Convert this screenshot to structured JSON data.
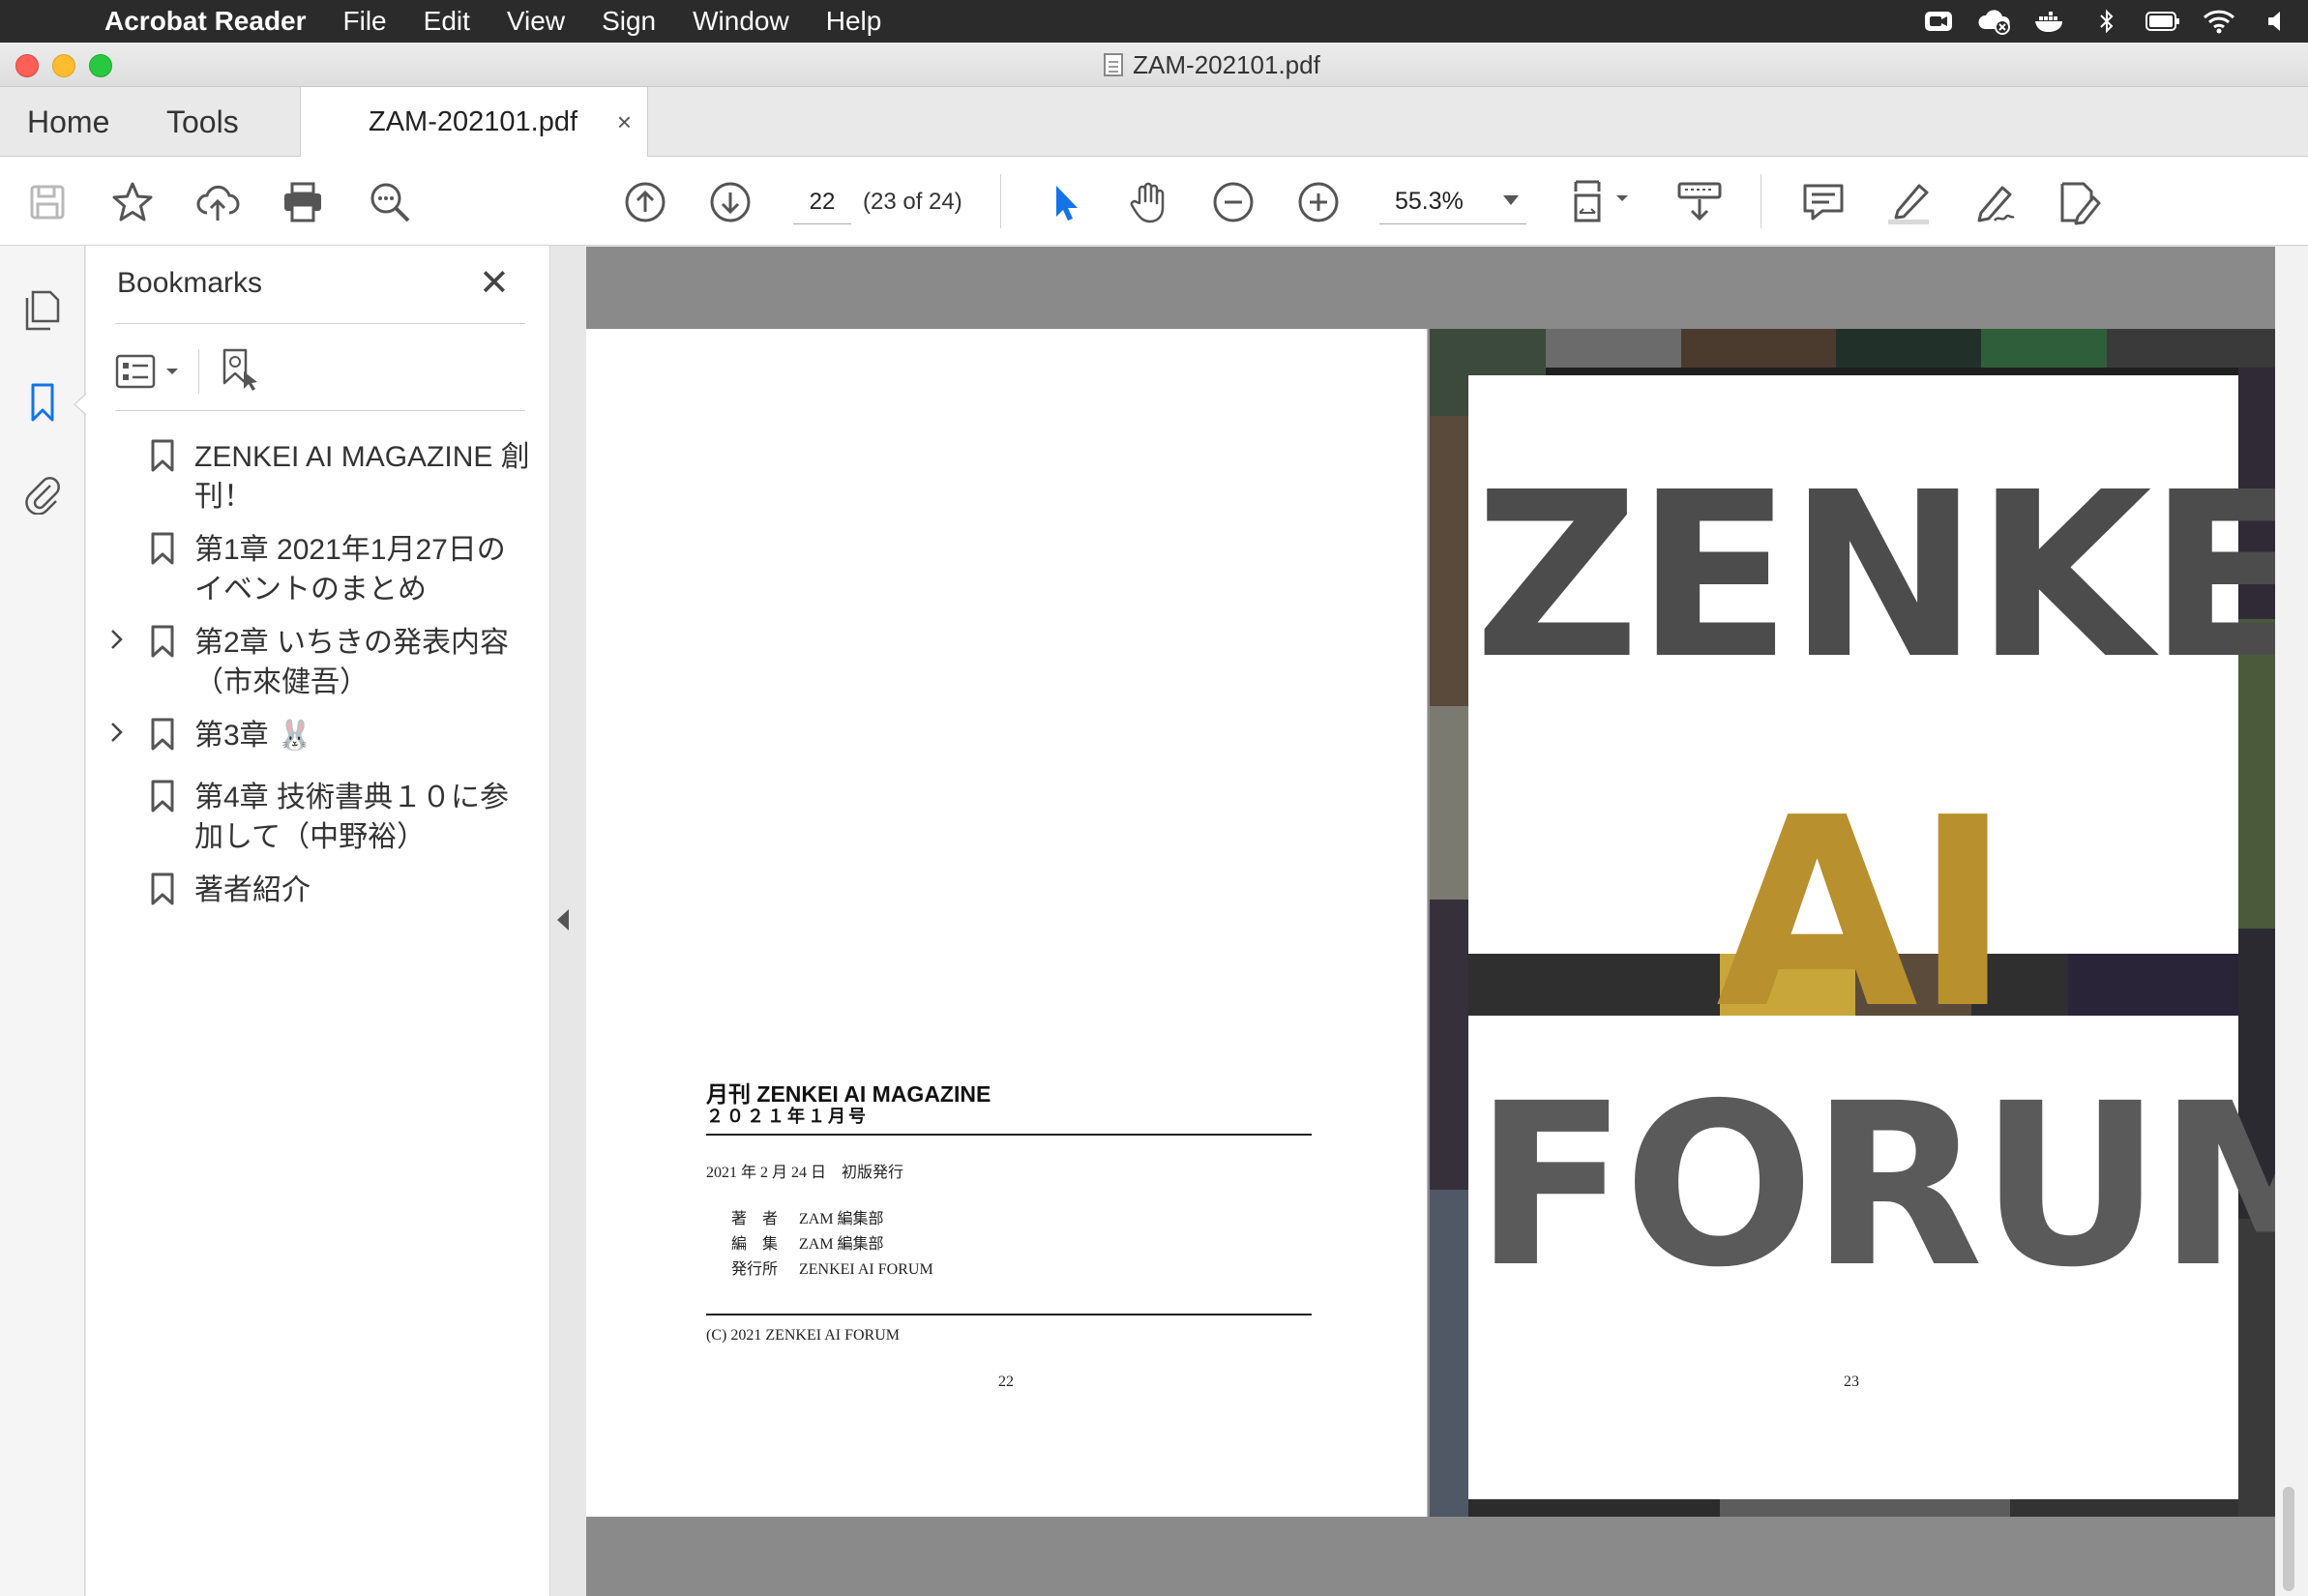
{
  "menubar": {
    "app_name": "Acrobat Reader",
    "items": [
      "File",
      "Edit",
      "View",
      "Sign",
      "Window",
      "Help"
    ]
  },
  "window": {
    "title": "ZAM-202101.pdf"
  },
  "tabs": {
    "home": "Home",
    "tools": "Tools",
    "document": "ZAM-202101.pdf",
    "close_glyph": "×"
  },
  "toolbar": {
    "page_current": "22",
    "page_count": "(23 of 24)",
    "zoom": "55.3%"
  },
  "bookmarks": {
    "title": "Bookmarks",
    "close_glyph": "✕",
    "items": [
      {
        "label": "ZENKEI AI MAGAZINE 創刊！",
        "expandable": false
      },
      {
        "label": "第1章 2021年1月27日のイベントのまとめ",
        "expandable": false
      },
      {
        "label": "第2章 いちきの発表内容（市來健吾）",
        "expandable": true
      },
      {
        "label": "第3章 🐰",
        "expandable": true
      },
      {
        "label": "第4章 技術書典１０に参加して（中野裕）",
        "expandable": false
      },
      {
        "label": "著者紹介",
        "expandable": false
      }
    ]
  },
  "page_left": {
    "magazine_title": "月刊 ZENKEI AI MAGAZINE",
    "issue": "２０２１年１月号",
    "published": "2021 年 2 月 24 日　初版発行",
    "credits": [
      {
        "key": "著　者",
        "value": "ZAM 編集部"
      },
      {
        "key": "編　集",
        "value": "ZAM 編集部"
      },
      {
        "key": "発行所",
        "value": "ZENKEI AI FORUM"
      }
    ],
    "copyright": "(C) 2021 ZENKEI AI FORUM",
    "page_number": "22"
  },
  "page_right": {
    "cover_words": [
      "ZENKEI",
      "AI",
      "FORUM"
    ],
    "page_number": "23"
  },
  "colors": {
    "accent": "#1473e6",
    "menubar_bg": "#2b2b2b",
    "viewer_bg": "#8a8a8a"
  }
}
